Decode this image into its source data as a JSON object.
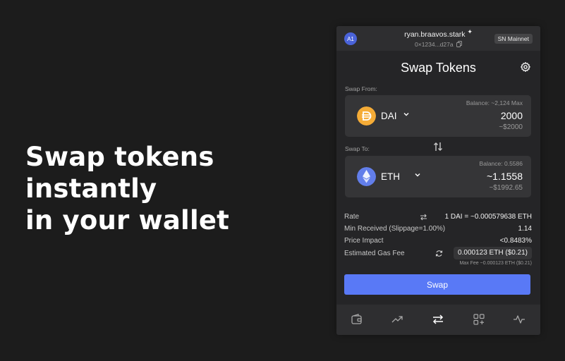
{
  "hero": {
    "line1": "Swap tokens",
    "line2": "instantly",
    "line3": "in your wallet"
  },
  "header": {
    "account_badge": "A1",
    "account_name": "ryan.braavos.stark",
    "account_address": "0×1234...d27a",
    "network": "SN Mainnet"
  },
  "title": "Swap Tokens",
  "swap_from": {
    "label": "Swap From:",
    "token": "DAI",
    "balance": "Balance: ~2,124 Max",
    "amount": "2000",
    "usd": "~$2000",
    "icon_color": "#f5ac37"
  },
  "swap_to": {
    "label": "Swap To:",
    "token": "ETH",
    "balance": "Balance: 0.5586",
    "amount": "~1.1558",
    "usd": "~$1992.65",
    "icon_color": "#627eea"
  },
  "details": {
    "rate_label": "Rate",
    "rate_value": "1 DAI = ~0.000579638 ETH",
    "min_received_label": "Min Received (Slippage=1.00%)",
    "min_received_value": "1.14",
    "price_impact_label": "Price Impact",
    "price_impact_value": "<0.8483%",
    "gas_label": "Estimated Gas Fee",
    "gas_value": "0.000123 ETH ($0.21)",
    "max_fee": "Max Fee ~0.000123 ETH ($0.21)"
  },
  "swap_button": "Swap",
  "nav": {
    "items": [
      "wallet-icon",
      "trending-icon",
      "swap-icon",
      "apps-icon",
      "activity-icon"
    ],
    "active": "swap-icon"
  },
  "colors": {
    "background": "#1c1c1c",
    "panel": "#252527",
    "card": "#353537",
    "accent": "#5979f6"
  }
}
